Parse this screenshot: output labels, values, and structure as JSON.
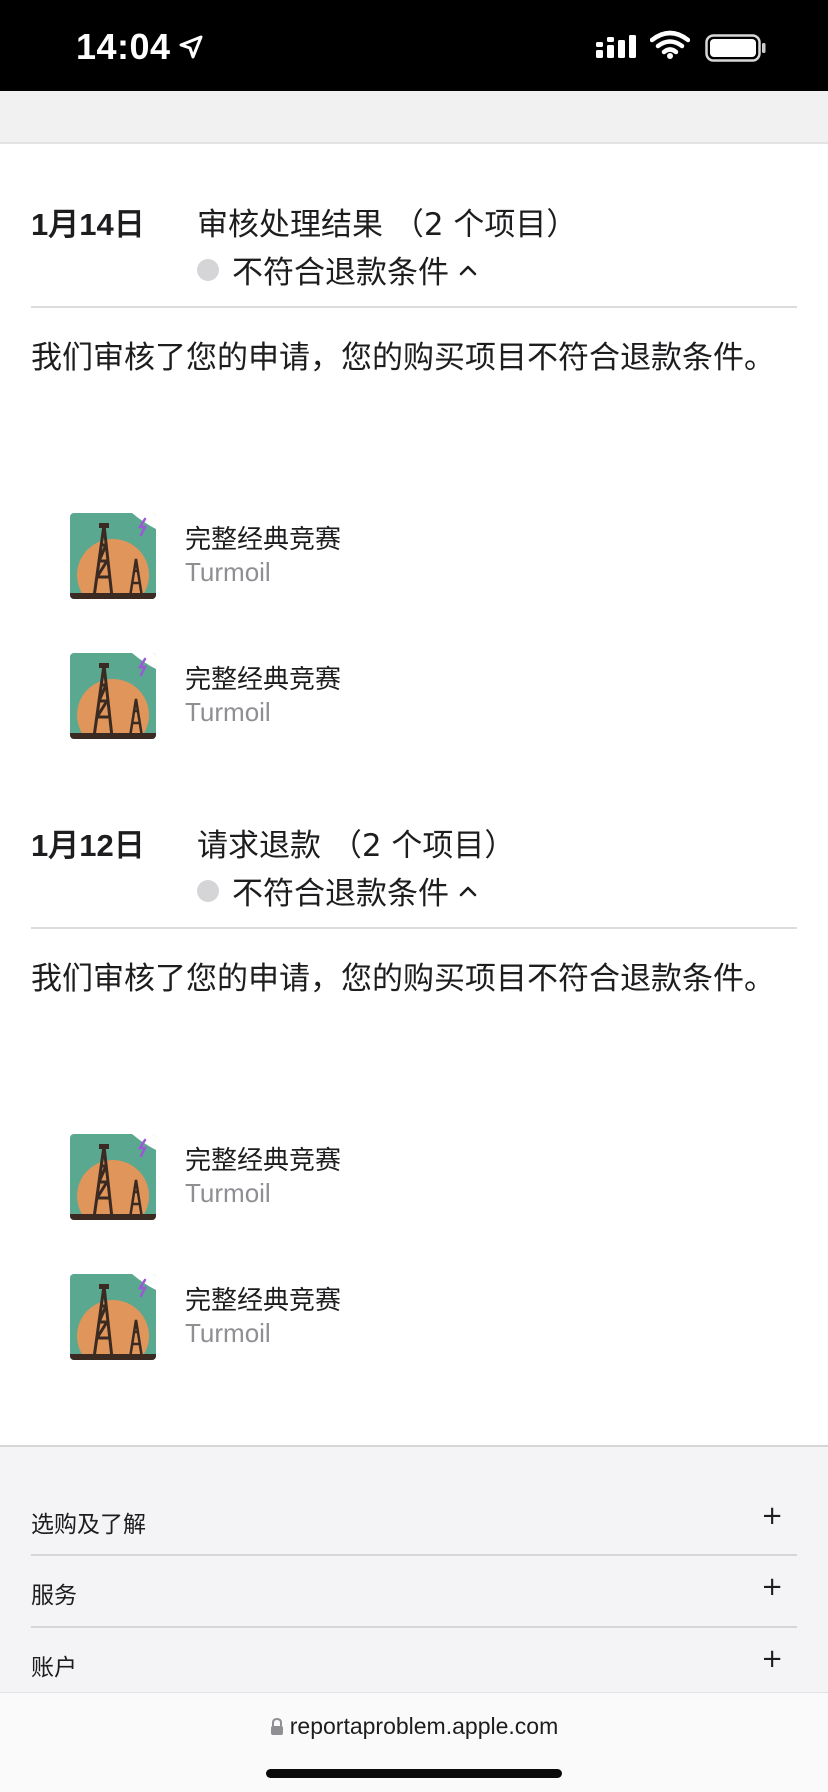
{
  "status_bar": {
    "time": "14:04",
    "icons": [
      "location-arrow-icon",
      "cellular-signal-icon",
      "wifi-icon",
      "battery-icon"
    ]
  },
  "groups": [
    {
      "date": "1月14日",
      "title": "审核处理结果 （2 个项目）",
      "status": "不符合退款条件",
      "description": "我们审核了您的申请，您的购买项目不符合退款条件。",
      "items": [
        {
          "name": "完整经典竞赛",
          "developer": "Turmoil"
        },
        {
          "name": "完整经典竞赛",
          "developer": "Turmoil"
        }
      ]
    },
    {
      "date": "1月12日",
      "title": "请求退款 （2 个项目）",
      "status": "不符合退款条件",
      "description": "我们审核了您的申请，您的购买项目不符合退款条件。",
      "items": [
        {
          "name": "完整经典竞赛",
          "developer": "Turmoil"
        },
        {
          "name": "完整经典竞赛",
          "developer": "Turmoil"
        }
      ]
    }
  ],
  "footer": {
    "rows": [
      {
        "label": "选购及了解",
        "toggle": "+"
      },
      {
        "label": "服务",
        "toggle": "+"
      },
      {
        "label": "账户",
        "toggle": "+"
      }
    ]
  },
  "browser": {
    "url": "reportaproblem.apple.com"
  }
}
